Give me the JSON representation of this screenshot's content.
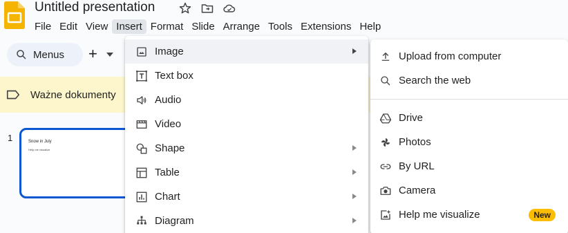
{
  "app": {
    "title": "Untitled presentation",
    "brand_color": "#f4b400"
  },
  "menubar": {
    "items": [
      {
        "label": "File"
      },
      {
        "label": "Edit"
      },
      {
        "label": "View"
      },
      {
        "label": "Insert",
        "active": true
      },
      {
        "label": "Format"
      },
      {
        "label": "Slide"
      },
      {
        "label": "Arrange"
      },
      {
        "label": "Tools"
      },
      {
        "label": "Extensions"
      },
      {
        "label": "Help"
      }
    ]
  },
  "toolbar": {
    "search_label": "Menus",
    "plus_label": "+"
  },
  "banner": {
    "text": "Ważne dokumenty"
  },
  "slides": [
    {
      "number": "1",
      "title": "Snow in July",
      "subtitle": "Help me visualize"
    }
  ],
  "insert_menu": {
    "items": [
      {
        "label": "Image",
        "icon": "image-icon",
        "submenu": true,
        "highlighted": true
      },
      {
        "label": "Text box",
        "icon": "text-box-icon",
        "submenu": false
      },
      {
        "label": "Audio",
        "icon": "audio-icon",
        "submenu": false
      },
      {
        "label": "Video",
        "icon": "video-icon",
        "submenu": false
      },
      {
        "label": "Shape",
        "icon": "shape-icon",
        "submenu": true
      },
      {
        "label": "Table",
        "icon": "table-icon",
        "submenu": true
      },
      {
        "label": "Chart",
        "icon": "chart-icon",
        "submenu": true
      },
      {
        "label": "Diagram",
        "icon": "diagram-icon",
        "submenu": true
      }
    ]
  },
  "image_submenu": {
    "upload": "Upload from computer",
    "search": "Search the web",
    "drive": "Drive",
    "photos": "Photos",
    "by_url": "By URL",
    "camera": "Camera",
    "visualize": "Help me visualize",
    "badge": "New",
    "badge_color": "#fbbc04"
  }
}
